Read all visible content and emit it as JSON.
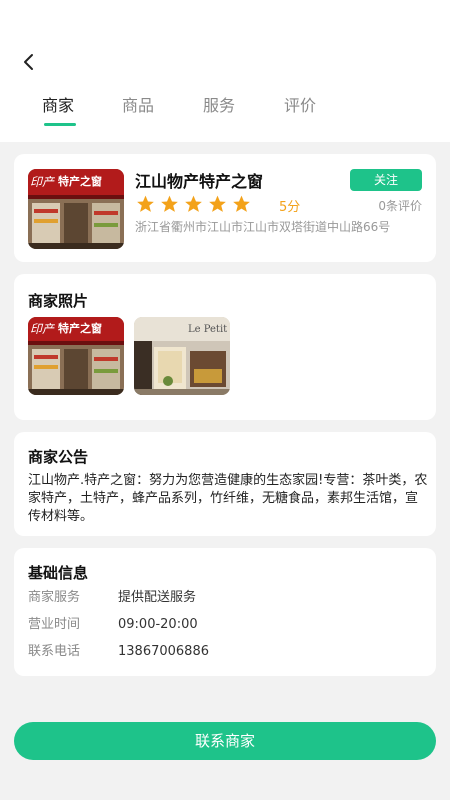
{
  "header": {
    "tabs": [
      {
        "label": "商家"
      },
      {
        "label": "商品"
      },
      {
        "label": "服务"
      },
      {
        "label": "评价"
      }
    ],
    "active_tab": "商家"
  },
  "shop": {
    "name": "江山物产特产之窗",
    "follow_label": "关注",
    "rating": 5,
    "rating_label": "5分",
    "review_count": "0条评价",
    "address": "浙江省衢州市江山市江山市双塔街道中山路66号",
    "sign_text": "特产之窗",
    "sign_prefix": "印产"
  },
  "photos": {
    "title": "商家照片",
    "items": [
      {
        "sign_text": "特产之窗"
      },
      {
        "sign_text": "Le Petit"
      }
    ]
  },
  "notice": {
    "title": "商家公告",
    "text": "江山物产.特产之窗：努力为您营造健康的生态家园!专营：茶叶类，农家特产，土特产，蜂产品系列，竹纤维，无糖食品，素邦生活馆，宣传材料等。"
  },
  "info": {
    "title": "基础信息",
    "rows": [
      {
        "label": "商家服务",
        "value": "提供配送服务"
      },
      {
        "label": "营业时间",
        "value": "09:00-20:00"
      },
      {
        "label": "联系电话",
        "value": "13867006886"
      }
    ]
  },
  "footer": {
    "contact_label": "联系商家"
  },
  "colors": {
    "accent": "#1ec38a",
    "star": "#f3a21a"
  }
}
